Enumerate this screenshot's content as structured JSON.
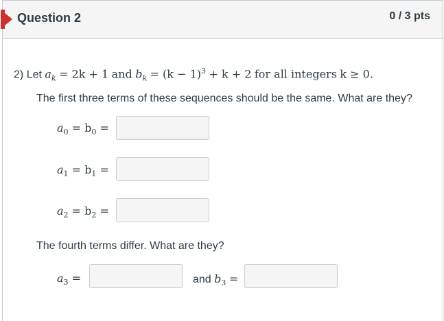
{
  "header": {
    "title": "Question 2",
    "points": "0 / 3 pts"
  },
  "question": {
    "number": "2)",
    "let": "Let",
    "a_def_lhs": "a",
    "a_def_sub": "k",
    "a_def_rhs": "= 2k + 1",
    "and": "and",
    "b_def_lhs": "b",
    "b_def_sub": "k",
    "b_def_rhs1": "= (k − 1)",
    "b_def_sup": "3",
    "b_def_rhs2": "+ k + 2",
    "for_all": "for all integers",
    "condition": "k ≥ 0.",
    "instruction1": "The first three terms of these sequences should be the same.  What are they?",
    "instruction2": "The fourth terms differ.  What are they?"
  },
  "answers": {
    "row0": {
      "label": "a",
      "sub": "0",
      "mid": "= b",
      "sub2": "0",
      "eq": "=",
      "value": ""
    },
    "row1": {
      "label": "a",
      "sub": "1",
      "mid": "= b",
      "sub2": "1",
      "eq": "=",
      "value": ""
    },
    "row2": {
      "label": "a",
      "sub": "2",
      "mid": "= b",
      "sub2": "2",
      "eq": "=",
      "value": ""
    },
    "a3": {
      "label": "a",
      "sub": "3",
      "eq": "=",
      "value": ""
    },
    "b3": {
      "prefix": "and",
      "label": "b",
      "sub": "3",
      "eq": "=",
      "value": ""
    }
  }
}
